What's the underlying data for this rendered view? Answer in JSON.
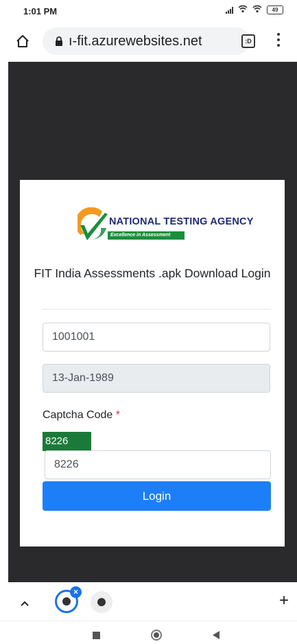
{
  "status_bar": {
    "time": "1:01 PM",
    "battery": "49",
    "icons": [
      "signal-icon",
      "wifi-icon",
      "battery-icon"
    ]
  },
  "browser": {
    "url": "ı-fit.azurewebsites.net",
    "tabs_count": ":D",
    "icons": [
      "home-icon",
      "lock-icon",
      "tabs-icon",
      "menu-icon"
    ]
  },
  "login_card": {
    "logo": {
      "name": "NATIONAL TESTING AGENCY",
      "tagline": "Excellence in Assessment"
    },
    "title": "FIT India Assessments .apk Download Login",
    "user_id_value": "1001001",
    "dob_value": "13-Jan-1989",
    "captcha_label": "Captcha Code",
    "required_marker": "*",
    "captcha_image_text": "8226",
    "captcha_input_value": "8226",
    "login_button_label": "Login"
  },
  "tab_strip": {
    "close_badge": "×",
    "new_tab": "+",
    "icons": [
      "chevron-up-icon",
      "globe-icon",
      "close-icon",
      "plus-icon"
    ]
  },
  "nav_bar": {
    "icons": [
      "recents-icon",
      "home-circle-icon",
      "back-icon"
    ]
  },
  "colors": {
    "login_button": "#1d7ff7",
    "captcha_bg": "#1b7a3a",
    "page_background": "#2a2a2c",
    "required": "#dc3545",
    "brand_blue": "#1b2a78",
    "brand_green": "#1a8f3a",
    "brand_orange": "#f39a1e",
    "tab_active": "#1a73e8"
  }
}
